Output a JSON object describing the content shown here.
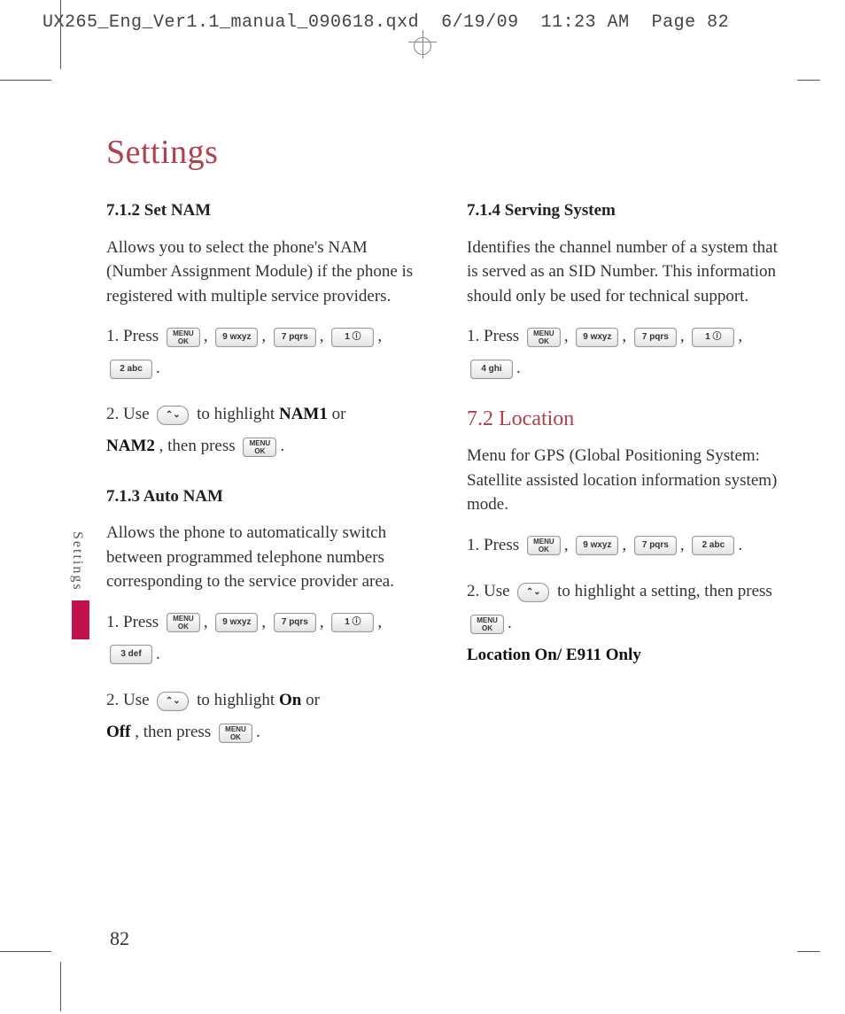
{
  "slug": "UX265_Eng_Ver1.1_manual_090618.qxd  6/19/09  11:23 AM  Page 82",
  "title": "Settings",
  "side_label": "Settings",
  "page_number": "82",
  "keys": {
    "ok": "MENU\nOK",
    "k9": "9 wxyz",
    "k7": "7 pqrs",
    "k1": "1 ⓘ",
    "k2": "2 abc",
    "k3": "3 def",
    "k4": "4 ghi",
    "nav": "⌃⌄"
  },
  "left": {
    "s1_head": "7.1.2 Set NAM",
    "s1_p": "Allows you to select the phone's NAM (Number Assignment Module) if the phone is registered with multiple service providers.",
    "s1_step1a": "1. Press ",
    "s1_step2a": "2. Use ",
    "s1_step2b": " to highlight ",
    "s1_nam1": "NAM1",
    "s1_or": " or ",
    "s1_nam2": "NAM2",
    "s1_then": ", then press ",
    "s2_head": "7.1.3 Auto NAM",
    "s2_p": "Allows the phone to automatically switch between programmed telephone numbers corresponding to the service provider area.",
    "s2_step1a": "1. Press ",
    "s2_step2a": "2. Use ",
    "s2_step2b": " to highlight ",
    "s2_on": "On",
    "s2_or": " or ",
    "s2_off": "Off",
    "s2_then": ", then press "
  },
  "right": {
    "s3_head": "7.1.4 Serving System",
    "s3_p": "Identifies the channel number of a system that is served as an SID Number. This information should only be used for technical support.",
    "s3_step1a": "1. Press ",
    "s4_head": "7.2 Location",
    "s4_p": "Menu for GPS (Global Positioning System: Satellite assisted location information system) mode.",
    "s4_step1a": "1. Press ",
    "s4_step2a": "2. Use ",
    "s4_step2b": " to highlight a setting, then press ",
    "s4_opts": "Location On/ E911 Only"
  }
}
